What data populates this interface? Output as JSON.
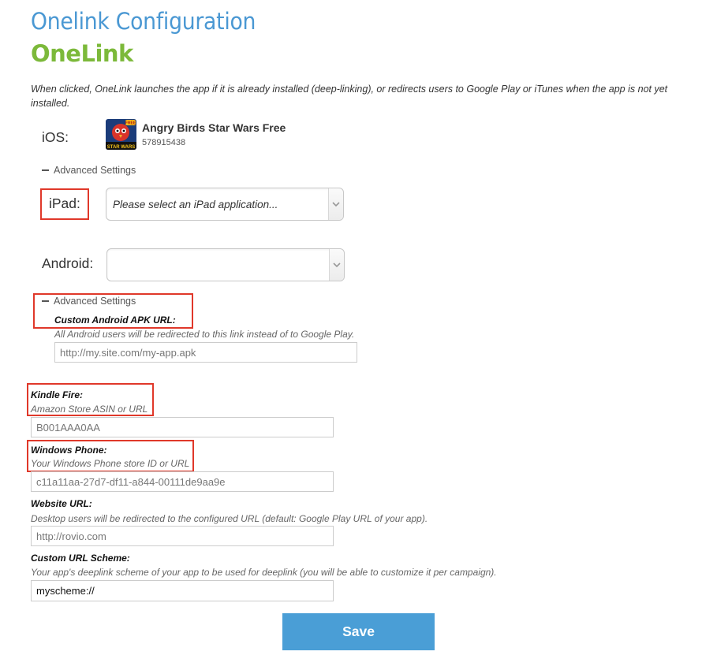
{
  "header": {
    "title": "Onelink Configuration",
    "logo_text": "OneLink"
  },
  "intro_text": "When clicked, OneLink launches the app if it is already installed (deep-linking), or redirects users to Google Play or iTunes when the app is not yet installed.",
  "ios": {
    "label": "iOS:",
    "app_name": "Angry Birds Star Wars Free",
    "app_id": "578915438",
    "icon": "angry-birds-star-wars-app-icon",
    "icon_badge_text": "FREE",
    "icon_subtitle": "STAR WARS",
    "advanced_label": "Advanced Settings"
  },
  "ipad": {
    "label": "iPad:",
    "select_value": "Please select an iPad application..."
  },
  "android": {
    "label": "Android:",
    "select_value": "",
    "advanced_label": "Advanced Settings",
    "apk_title": "Custom Android APK URL:",
    "apk_desc": "All Android users will be redirected to this link instead of to Google Play.",
    "apk_placeholder": "http://my.site.com/my-app.apk"
  },
  "kindle": {
    "title": "Kindle Fire:",
    "desc": "Amazon Store ASIN or URL",
    "placeholder": "B001AAA0AA"
  },
  "windows_phone": {
    "title": "Windows Phone:",
    "desc": "Your Windows Phone store ID or URL",
    "placeholder": "c11a11aa-27d7-df11-a844-00111de9aa9e"
  },
  "website": {
    "title": "Website URL:",
    "desc": "Desktop users will be redirected to the configured URL (default: Google Play URL of your app).",
    "placeholder": "http://rovio.com"
  },
  "url_scheme": {
    "title": "Custom URL Scheme:",
    "desc": "Your app's deeplink scheme of your app to be used for deeplink (you will be able to customize it per campaign).",
    "value": "myscheme://"
  },
  "save_label": "Save",
  "colors": {
    "title_blue": "#4a98d3",
    "logo_green": "#7cb93a",
    "highlight_red": "#e0382a",
    "button_blue": "#4a9ed6"
  }
}
